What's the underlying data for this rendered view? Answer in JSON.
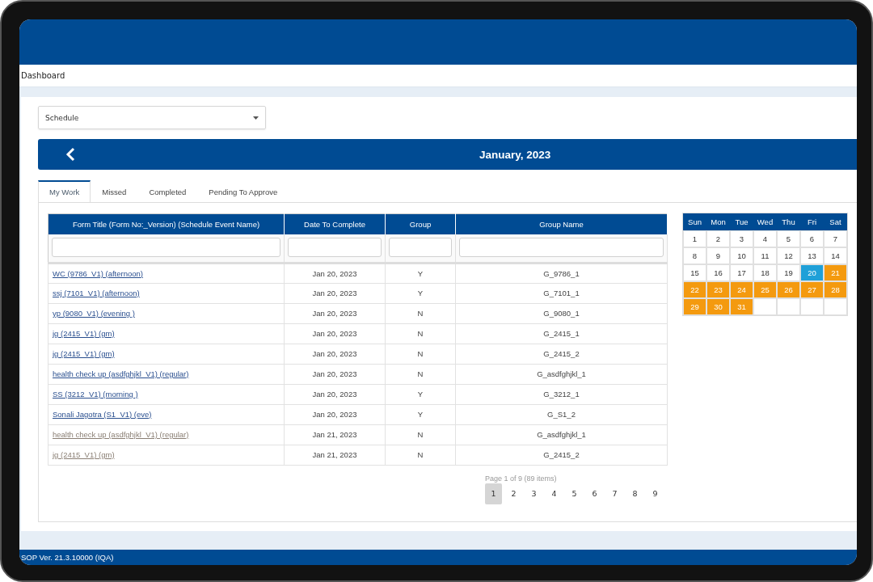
{
  "breadcrumb": "Dashboard",
  "view_select": {
    "value": "Schedule"
  },
  "calendar_banner": {
    "title": "January, 2023"
  },
  "tabs": [
    {
      "label": "My Work",
      "selected": true
    },
    {
      "label": "Missed",
      "selected": false
    },
    {
      "label": "Completed",
      "selected": false
    },
    {
      "label": "Pending To Approve",
      "selected": false
    }
  ],
  "table": {
    "columns": [
      "Form Title (Form No:_Version) (Schedule Event Name)",
      "Date To Complete",
      "Group",
      "Group Name"
    ],
    "rows": [
      {
        "form_title": "WC (9786_V1) (afternoon)",
        "date": "Jan 20, 2023",
        "group": "Y",
        "group_name": "G_9786_1",
        "dimmed": false
      },
      {
        "form_title": "ssj (7101_V1) (afternoon)",
        "date": "Jan 20, 2023",
        "group": "Y",
        "group_name": "G_7101_1",
        "dimmed": false
      },
      {
        "form_title": "yp (9080_V1) (evening )",
        "date": "Jan 20, 2023",
        "group": "N",
        "group_name": "G_9080_1",
        "dimmed": false
      },
      {
        "form_title": "jg (2415_V1) (gm)",
        "date": "Jan 20, 2023",
        "group": "N",
        "group_name": "G_2415_1",
        "dimmed": false
      },
      {
        "form_title": "jg (2415_V1) (gm)",
        "date": "Jan 20, 2023",
        "group": "N",
        "group_name": "G_2415_2",
        "dimmed": false
      },
      {
        "form_title": "health check up (asdfghjkl_V1) (regular)",
        "date": "Jan 20, 2023",
        "group": "N",
        "group_name": "G_asdfghjkl_1",
        "dimmed": false
      },
      {
        "form_title": "SS (3212_V1) (morning )",
        "date": "Jan 20, 2023",
        "group": "Y",
        "group_name": "G_3212_1",
        "dimmed": false
      },
      {
        "form_title": "Sonali Jagotra  (S1_V1) (eve)",
        "date": "Jan 20, 2023",
        "group": "Y",
        "group_name": "G_S1_2",
        "dimmed": false
      },
      {
        "form_title": "health check up (asdfghjkl_V1) (regular)",
        "date": "Jan 21, 2023",
        "group": "N",
        "group_name": "G_asdfghjkl_1",
        "dimmed": true
      },
      {
        "form_title": "jg (2415_V1) (gm)",
        "date": "Jan 21, 2023",
        "group": "N",
        "group_name": "G_2415_2",
        "dimmed": true
      }
    ]
  },
  "pager": {
    "info": "Page 1 of 9 (89 items)",
    "pages": [
      {
        "label": "1",
        "selected": true
      },
      {
        "label": "2",
        "selected": false
      },
      {
        "label": "3",
        "selected": false
      },
      {
        "label": "4",
        "selected": false
      },
      {
        "label": "5",
        "selected": false
      },
      {
        "label": "6",
        "selected": false
      },
      {
        "label": "7",
        "selected": false
      },
      {
        "label": "8",
        "selected": false
      },
      {
        "label": "9",
        "selected": false
      }
    ]
  },
  "mini_calendar": {
    "weekdays": [
      "Sun",
      "Mon",
      "Tue",
      "Wed",
      "Thu",
      "Fri",
      "Sat"
    ],
    "days": [
      {
        "label": "1",
        "kind": "plain"
      },
      {
        "label": "2",
        "kind": "plain"
      },
      {
        "label": "3",
        "kind": "plain"
      },
      {
        "label": "4",
        "kind": "plain"
      },
      {
        "label": "5",
        "kind": "plain"
      },
      {
        "label": "6",
        "kind": "plain"
      },
      {
        "label": "7",
        "kind": "plain"
      },
      {
        "label": "8",
        "kind": "plain"
      },
      {
        "label": "9",
        "kind": "plain"
      },
      {
        "label": "10",
        "kind": "plain"
      },
      {
        "label": "11",
        "kind": "plain"
      },
      {
        "label": "12",
        "kind": "plain"
      },
      {
        "label": "13",
        "kind": "plain"
      },
      {
        "label": "14",
        "kind": "plain"
      },
      {
        "label": "15",
        "kind": "plain"
      },
      {
        "label": "16",
        "kind": "plain"
      },
      {
        "label": "17",
        "kind": "plain"
      },
      {
        "label": "18",
        "kind": "plain"
      },
      {
        "label": "19",
        "kind": "plain"
      },
      {
        "label": "20",
        "kind": "today"
      },
      {
        "label": "21",
        "kind": "scheduled"
      },
      {
        "label": "22",
        "kind": "scheduled"
      },
      {
        "label": "23",
        "kind": "scheduled"
      },
      {
        "label": "24",
        "kind": "scheduled"
      },
      {
        "label": "25",
        "kind": "scheduled"
      },
      {
        "label": "26",
        "kind": "scheduled"
      },
      {
        "label": "27",
        "kind": "scheduled"
      },
      {
        "label": "28",
        "kind": "scheduled"
      },
      {
        "label": "29",
        "kind": "scheduled"
      },
      {
        "label": "30",
        "kind": "scheduled"
      },
      {
        "label": "31",
        "kind": "scheduled"
      }
    ]
  },
  "footer": {
    "version": "SOP Ver. 21.3.10000 (IQA)"
  }
}
